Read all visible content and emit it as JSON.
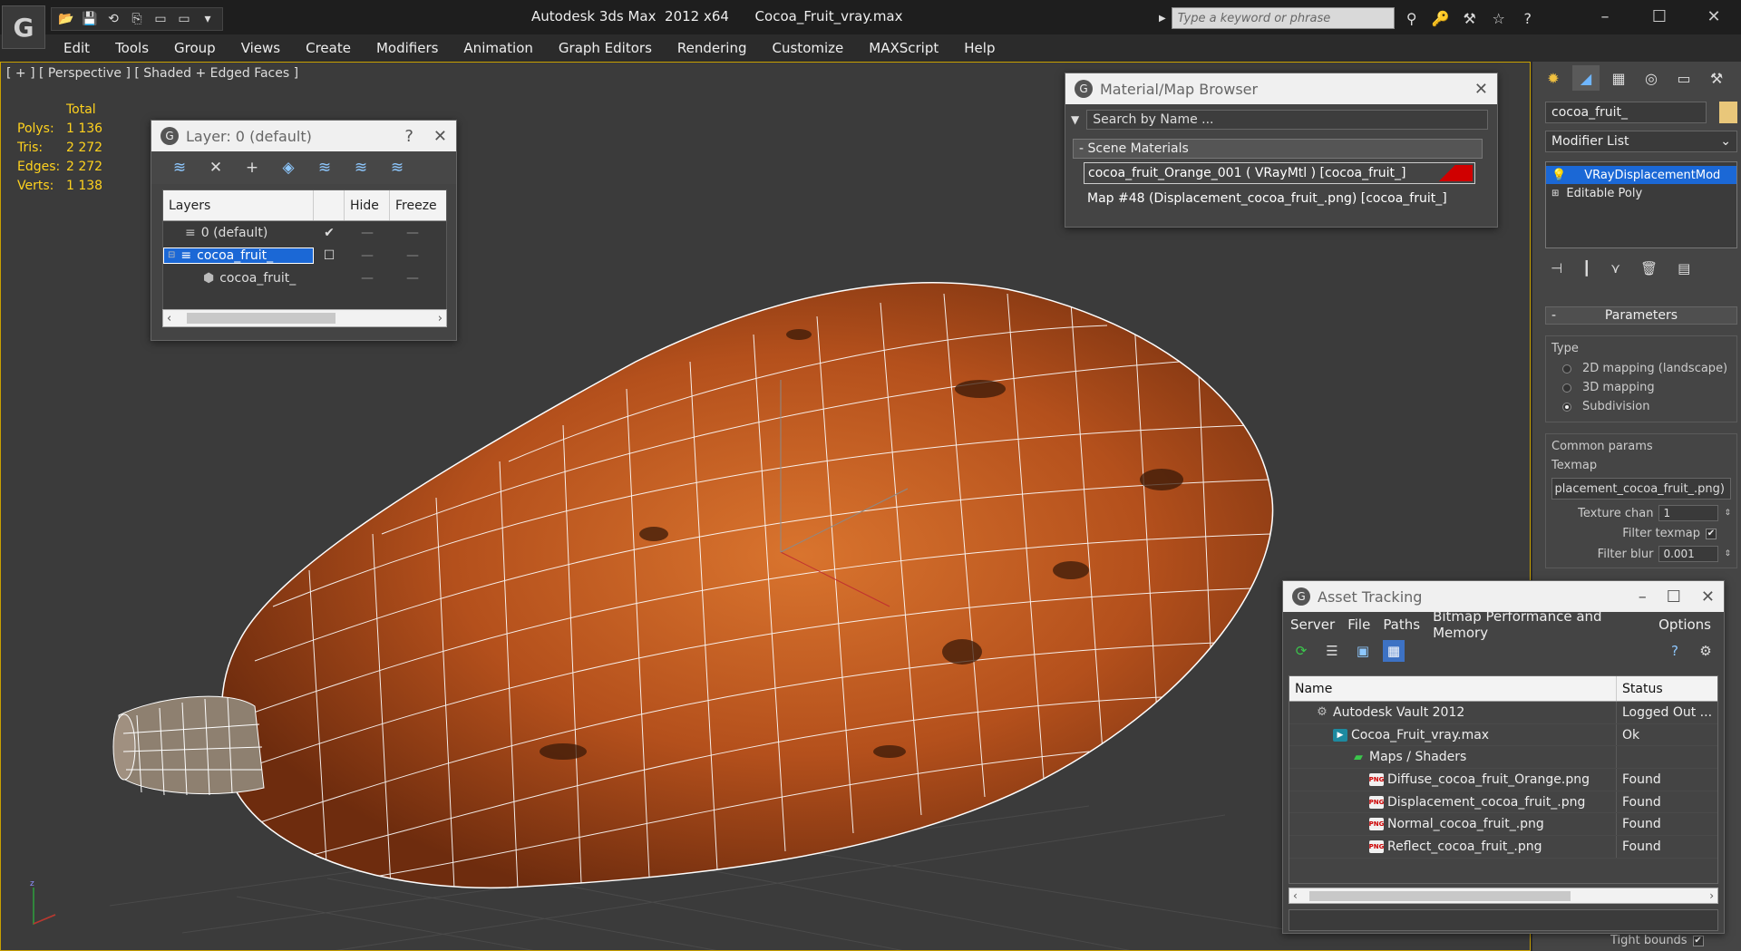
{
  "window": {
    "title": "Autodesk 3ds Max  2012 x64      Cocoa_Fruit_vray.max",
    "search_placeholder": "Type a keyword or phrase",
    "controls": [
      "–",
      "☐",
      "✕"
    ]
  },
  "quick_access": [
    "📂",
    "💾",
    "⟲",
    "⎘",
    "▭",
    "▭",
    "▾"
  ],
  "menu": [
    "Edit",
    "Tools",
    "Group",
    "Views",
    "Create",
    "Modifiers",
    "Animation",
    "Graph Editors",
    "Rendering",
    "Customize",
    "MAXScript",
    "Help"
  ],
  "viewport": {
    "label": "[ + ] [ Perspective ] [ Shaded + Edged Faces ]",
    "stats_header": "Total",
    "stats": [
      {
        "key": "Polys:",
        "value": "1 136"
      },
      {
        "key": "Tris:",
        "value": "2 272"
      },
      {
        "key": "Edges:",
        "value": "2 272"
      },
      {
        "key": "Verts:",
        "value": "1 138"
      }
    ]
  },
  "layer_panel": {
    "title": "Layer: 0 (default)",
    "help": "?",
    "close": "✕",
    "columns": [
      "Layers",
      "",
      "Hide",
      "Freeze"
    ],
    "rows": [
      {
        "name": "0 (default)",
        "check": "✔",
        "hide": "—",
        "freeze": "—"
      },
      {
        "name": "cocoa_fruit_",
        "check": "☐",
        "hide": "—",
        "freeze": "—"
      },
      {
        "name": "cocoa_fruit_",
        "check": "",
        "hide": "—",
        "freeze": "—"
      }
    ]
  },
  "material_browser": {
    "title": "Material/Map Browser",
    "search_placeholder": "Search by Name ...",
    "section": "- Scene Materials",
    "items": [
      "cocoa_fruit_Orange_001  ( VRayMtl )  [cocoa_fruit_]",
      "Map #48 (Displacement_cocoa_fruit_.png) [cocoa_fruit_]"
    ]
  },
  "command_panel": {
    "object_name": "cocoa_fruit_",
    "modifier_list": "Modifier List",
    "stack": [
      "VRayDisplacementMod",
      "Editable Poly"
    ],
    "params_title": "Parameters",
    "type_label": "Type",
    "type_options": [
      {
        "label": "2D mapping (landscape)",
        "on": false
      },
      {
        "label": "3D mapping",
        "on": false
      },
      {
        "label": "Subdivision",
        "on": true
      }
    ],
    "common_label": "Common params",
    "texmap_label": "Texmap",
    "texmap_value": "placement_cocoa_fruit_.png)",
    "texture_chan_label": "Texture chan",
    "texture_chan_value": "1",
    "filter_texmap_label": "Filter texmap",
    "filter_blur_label": "Filter blur",
    "filter_blur_value": "0.001",
    "tight_bounds_label": "Tight bounds"
  },
  "asset_tracking": {
    "title": "Asset Tracking",
    "menu": [
      "Server",
      "File",
      "Paths",
      "Bitmap Performance and Memory",
      "Options"
    ],
    "columns": [
      "Name",
      "Status"
    ],
    "rows": [
      {
        "name": "Autodesk Vault 2012",
        "status": "Logged Out ...",
        "indent": 1,
        "icon": "vault"
      },
      {
        "name": "Cocoa_Fruit_vray.max",
        "status": "Ok",
        "indent": 2,
        "icon": "max"
      },
      {
        "name": "Maps / Shaders",
        "status": "",
        "indent": 3,
        "icon": "folder"
      },
      {
        "name": "Diffuse_cocoa_fruit_Orange.png",
        "status": "Found",
        "indent": 4,
        "icon": "png"
      },
      {
        "name": "Displacement_cocoa_fruit_.png",
        "status": "Found",
        "indent": 4,
        "icon": "png"
      },
      {
        "name": "Normal_cocoa_fruit_.png",
        "status": "Found",
        "indent": 4,
        "icon": "png"
      },
      {
        "name": "Reflect_cocoa_fruit_.png",
        "status": "Found",
        "indent": 4,
        "icon": "png"
      }
    ]
  },
  "colors": {
    "accent": "#1b68d6",
    "stats": "#ffd21e",
    "fruit": "#b4501c",
    "wire": "#ffffff"
  }
}
